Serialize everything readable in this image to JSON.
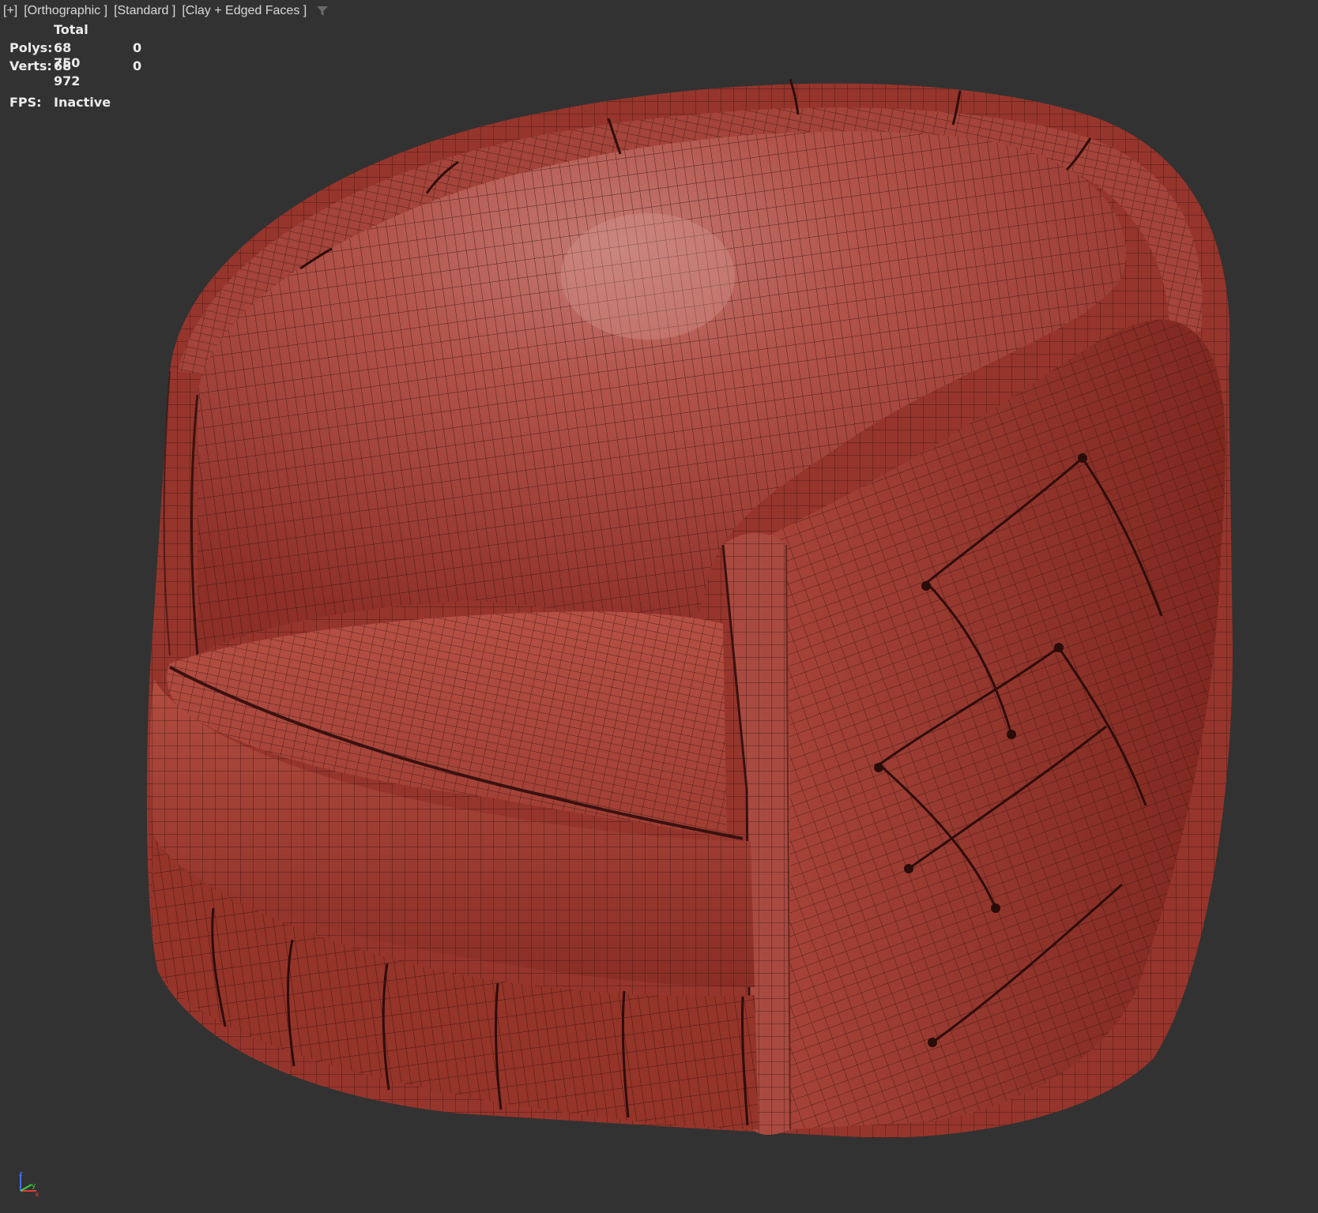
{
  "viewport": {
    "label_items": [
      "[+]",
      "[Orthographic ]",
      "[Standard ]",
      "[Clay + Edged Faces ]"
    ],
    "filter_icon": "filter-icon"
  },
  "stats": {
    "header": "Total",
    "polys_label": "Polys:",
    "polys_total": "68 750",
    "polys_selected": "0",
    "verts_label": "Verts:",
    "verts_total": "68 972",
    "verts_selected": "0",
    "fps_label": "FPS:",
    "fps_value": "Inactive"
  },
  "axis_gizmo": {
    "x": "x",
    "y": "y",
    "z": "z"
  },
  "colors": {
    "background": "#323232",
    "clay": "#a8443a",
    "clay_dark": "#6e2620",
    "wire": "#3a1410"
  }
}
